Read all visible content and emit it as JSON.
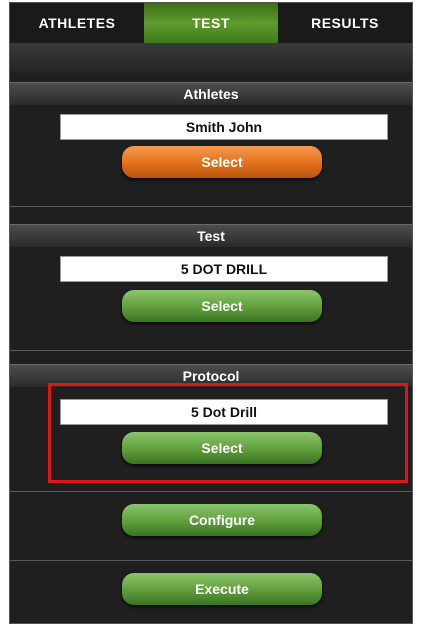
{
  "tabs": [
    {
      "label": "ATHLETES",
      "active": false
    },
    {
      "label": "TEST",
      "active": true
    },
    {
      "label": "RESULTS",
      "active": false
    }
  ],
  "sections": {
    "athletes": {
      "title": "Athletes",
      "value": "Smith John",
      "button": "Select"
    },
    "test": {
      "title": "Test",
      "value": "5 DOT DRILL",
      "button": "Select"
    },
    "protocol": {
      "title": "Protocol",
      "value": "5 Dot Drill",
      "button": "Select"
    }
  },
  "actions": {
    "configure": "Configure",
    "execute": "Execute"
  },
  "colors": {
    "orange_button": "#e2701a",
    "green_button": "#5f9d3c",
    "active_tab": "#5e9a2c",
    "highlight": "#e0151a"
  }
}
